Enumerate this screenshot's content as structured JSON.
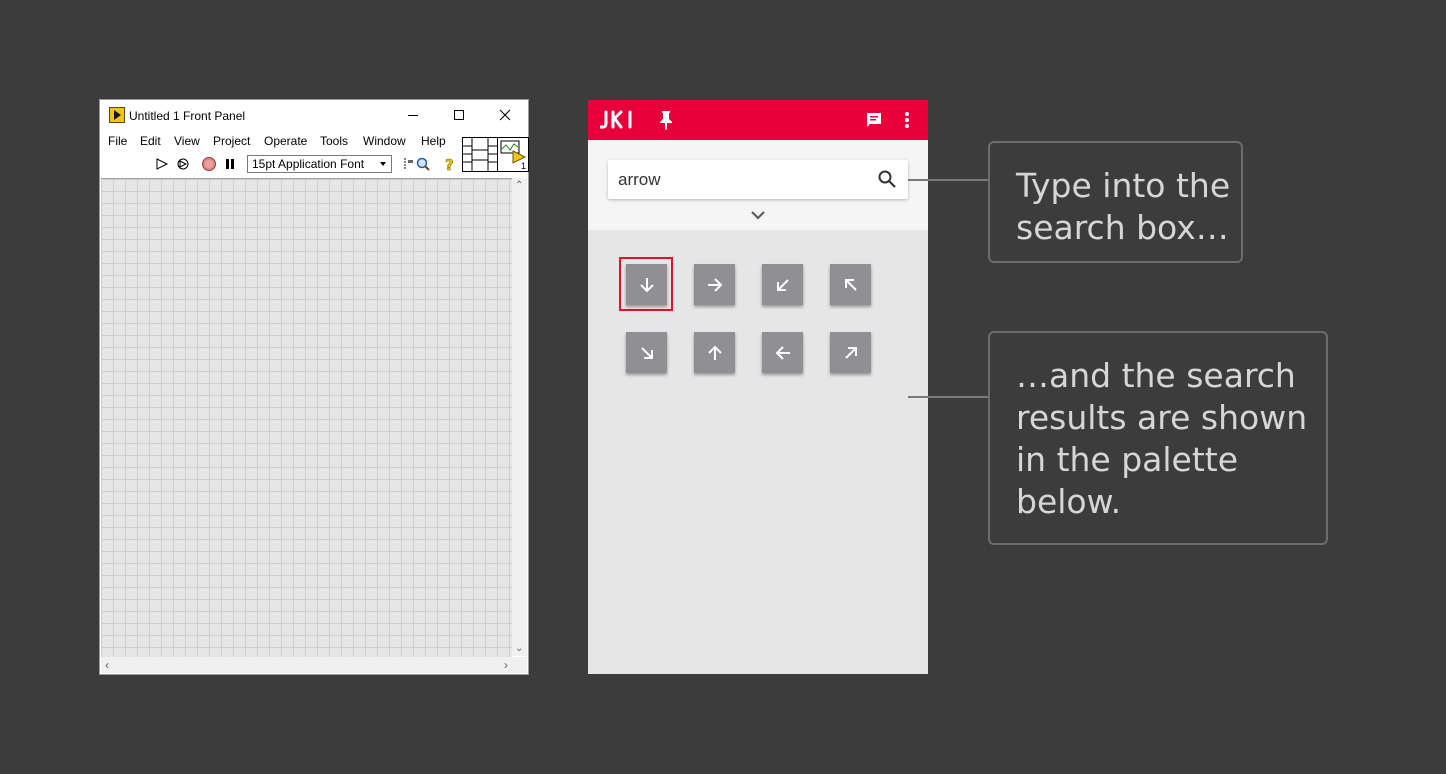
{
  "labview": {
    "title": "Untitled 1 Front Panel",
    "menu": [
      "File",
      "Edit",
      "View",
      "Project",
      "Operate",
      "Tools",
      "Window",
      "Help"
    ],
    "font_select": "15pt Application Font",
    "vi_icon_number": "1"
  },
  "jki": {
    "search": {
      "value": "arrow"
    },
    "results": [
      {
        "icon": "arrow-down-icon",
        "selected": true
      },
      {
        "icon": "arrow-right-icon",
        "selected": false
      },
      {
        "icon": "arrow-down-left-icon",
        "selected": false
      },
      {
        "icon": "arrow-up-left-icon",
        "selected": false
      },
      {
        "icon": "arrow-down-right-icon",
        "selected": false
      },
      {
        "icon": "arrow-up-icon",
        "selected": false
      },
      {
        "icon": "arrow-left-icon",
        "selected": false
      },
      {
        "icon": "arrow-up-right-icon",
        "selected": false
      }
    ],
    "colors": {
      "header": "#e8003a",
      "tile": "#8f8f94",
      "selection": "#e0102f"
    }
  },
  "callouts": [
    {
      "lines": [
        "Type into the",
        "search box…"
      ]
    },
    {
      "lines": [
        "…and the search",
        "results are shown",
        "in the palette",
        "below."
      ]
    }
  ]
}
